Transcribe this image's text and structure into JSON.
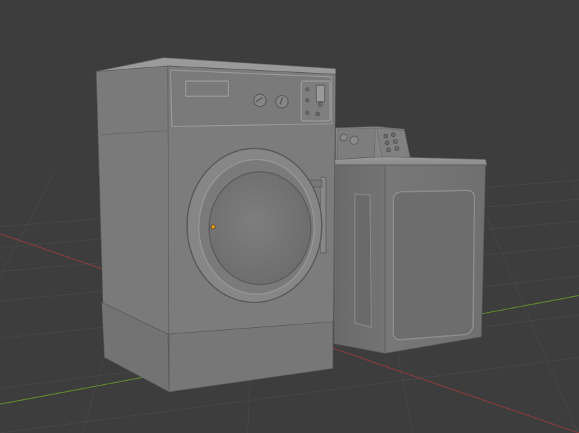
{
  "viewport": {
    "background_color": "#3d3d3d",
    "grid_color": "#4a4a4a",
    "axis_x_color": "#9a3b3b",
    "axis_y_color": "#6e9a2e",
    "origin_marker_color": "#f0a020"
  },
  "scene": {
    "objects": [
      "front-load-washer",
      "top-load-washer"
    ],
    "model_color": "#7b7b7b"
  }
}
